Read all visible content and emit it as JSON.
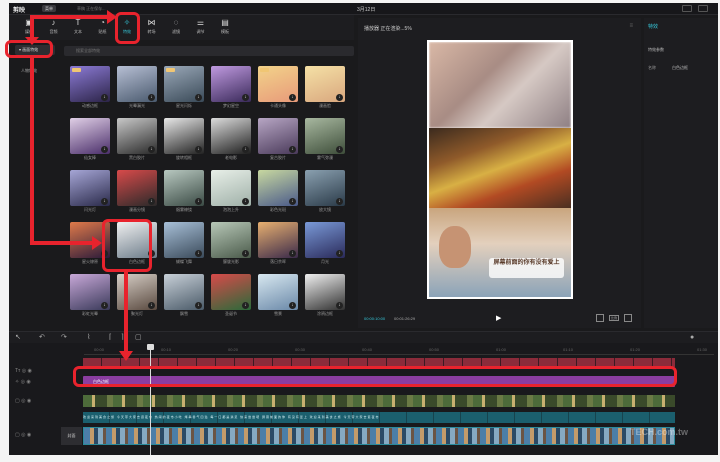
{
  "app": {
    "logo": "剪映",
    "menu_label": "菜单",
    "project": "草稿 正在保存...",
    "date": "3月12日"
  },
  "toolbar": {
    "items": [
      {
        "label": "媒体",
        "icon": "media-icon",
        "glyph": "▣"
      },
      {
        "label": "音频",
        "icon": "audio-icon",
        "glyph": "♪"
      },
      {
        "label": "文本",
        "icon": "text-icon",
        "glyph": "T"
      },
      {
        "label": "贴纸",
        "icon": "sticker-icon",
        "glyph": "◔"
      },
      {
        "label": "特效",
        "icon": "effects-icon",
        "glyph": "✧"
      },
      {
        "label": "转场",
        "icon": "transition-icon",
        "glyph": "⋈"
      },
      {
        "label": "滤镜",
        "icon": "filter-icon",
        "glyph": "◌"
      },
      {
        "label": "调节",
        "icon": "adjust-icon",
        "glyph": "⚌"
      },
      {
        "label": "模板",
        "icon": "template-icon",
        "glyph": "▤"
      }
    ]
  },
  "sidebar": {
    "items": [
      {
        "label": "▾ 画面特效"
      },
      {
        "label": "人物特效"
      }
    ]
  },
  "search": {
    "placeholder": "搜索全部特效"
  },
  "effects": [
    {
      "name": "动感边框",
      "c1": "#8c7bd6",
      "c2": "#2c2448"
    },
    {
      "name": "光晕漏光",
      "c1": "#b7bfd4",
      "c2": "#4a5a6e"
    },
    {
      "name": "星光闪烁",
      "c1": "#9aa8b8",
      "c2": "#3a4a58"
    },
    {
      "name": "梦幻星空",
      "c1": "#c09ae0",
      "c2": "#3a2a5a"
    },
    {
      "name": "卡通头像",
      "c1": "#f2d38a",
      "c2": "#e89a7a"
    },
    {
      "name": "漫画脸",
      "c1": "#f5e1a6",
      "c2": "#d9a77e"
    },
    {
      "name": "仙女棒",
      "c1": "#e0cfe6",
      "c2": "#4a2e6a"
    },
    {
      "name": "黑白胶片",
      "c1": "#c8c8c8",
      "c2": "#2a2a2a"
    },
    {
      "name": "旋转相框",
      "c1": "#e8e8e8",
      "c2": "#222222"
    },
    {
      "name": "老电影",
      "c1": "#dcdcdc",
      "c2": "#1e1e1e"
    },
    {
      "name": "复古胶片",
      "c1": "#b7a6c4",
      "c2": "#4a3a5a"
    },
    {
      "name": "雾气弥漫",
      "c1": "#a8b8a0",
      "c2": "#3e4e3a"
    },
    {
      "name": "闪光灯",
      "c1": "#a6a6d6",
      "c2": "#2a2a4a"
    },
    {
      "name": "漫画分镜",
      "c1": "#d84a4a",
      "c2": "#2a2a2a"
    },
    {
      "name": "烟雾缭绕",
      "c1": "#b8c8c0",
      "c2": "#3a4a44"
    },
    {
      "name": "泡泡上升",
      "c1": "#e8efe8",
      "c2": "#9fb0a8"
    },
    {
      "name": "彩色光斑",
      "c1": "#c8d8a0",
      "c2": "#4a5a8a"
    },
    {
      "name": "放大镜",
      "c1": "#8aa0b0",
      "c2": "#2a3a48"
    },
    {
      "name": "星火燎原",
      "c1": "#e07a4a",
      "c2": "#2a1a3a"
    },
    {
      "name": "白色边框",
      "c1": "#f0f0f0",
      "c2": "#6a7a88"
    },
    {
      "name": "蝴蝶飞舞",
      "c1": "#a8c0d8",
      "c2": "#3a4a5a"
    },
    {
      "name": "朦胧光影",
      "c1": "#b8c8b8",
      "c2": "#4a5a4a"
    },
    {
      "name": "落日余晖",
      "c1": "#e8b070",
      "c2": "#3a2a4a"
    },
    {
      "name": "月光",
      "c1": "#7a9ad8",
      "c2": "#2a2a5a"
    },
    {
      "name": "彩虹光晕",
      "c1": "#c8a8d8",
      "c2": "#3a3a5a"
    },
    {
      "name": "聚光灯",
      "c1": "#d8d0c8",
      "c2": "#5a4a40"
    },
    {
      "name": "飘雪",
      "c1": "#c8d0d8",
      "c2": "#4a5a68"
    },
    {
      "name": "圣诞节",
      "c1": "#d84a4a",
      "c2": "#2a6a3a"
    },
    {
      "name": "雪景",
      "c1": "#d8e8f0",
      "c2": "#6a88a8"
    },
    {
      "name": "涂鸦边框",
      "c1": "#f0f0f0",
      "c2": "#303030"
    }
  ],
  "player": {
    "title": "播放器 正在渲染...5%",
    "current_time": "00:00:10:00",
    "total_time": "00:01:26:29",
    "caption": "屏幕前面的你有没有爱上",
    "ratio_label": "比例"
  },
  "properties": {
    "header": "特效",
    "section": "特效参数",
    "name_label": "名称",
    "name_value": "白色边框"
  },
  "timeline": {
    "ruler_ticks": [
      "00:00",
      "00:10",
      "00:20",
      "00:30",
      "00:40",
      "00:50",
      "01:00",
      "01:10",
      "01:20",
      "01:30"
    ],
    "effect_clip_label": "白色边框",
    "subtitle_text": "欢迎来到美食之旅 今天带大家去逛夜市 热闹的夜市小吃 烤串香气四溢 每一口都是满足 快来尝尝吧 屏幕前面的你 有没有爱上 欢迎来到美食之旅 今天带大家去逛夜市",
    "cover_label": "封面"
  },
  "watermark": "TECH.com.tw",
  "colors": {
    "accent": "#35c7d9",
    "highlight": "#e8232d",
    "effect_clip": "#8a3da0"
  }
}
